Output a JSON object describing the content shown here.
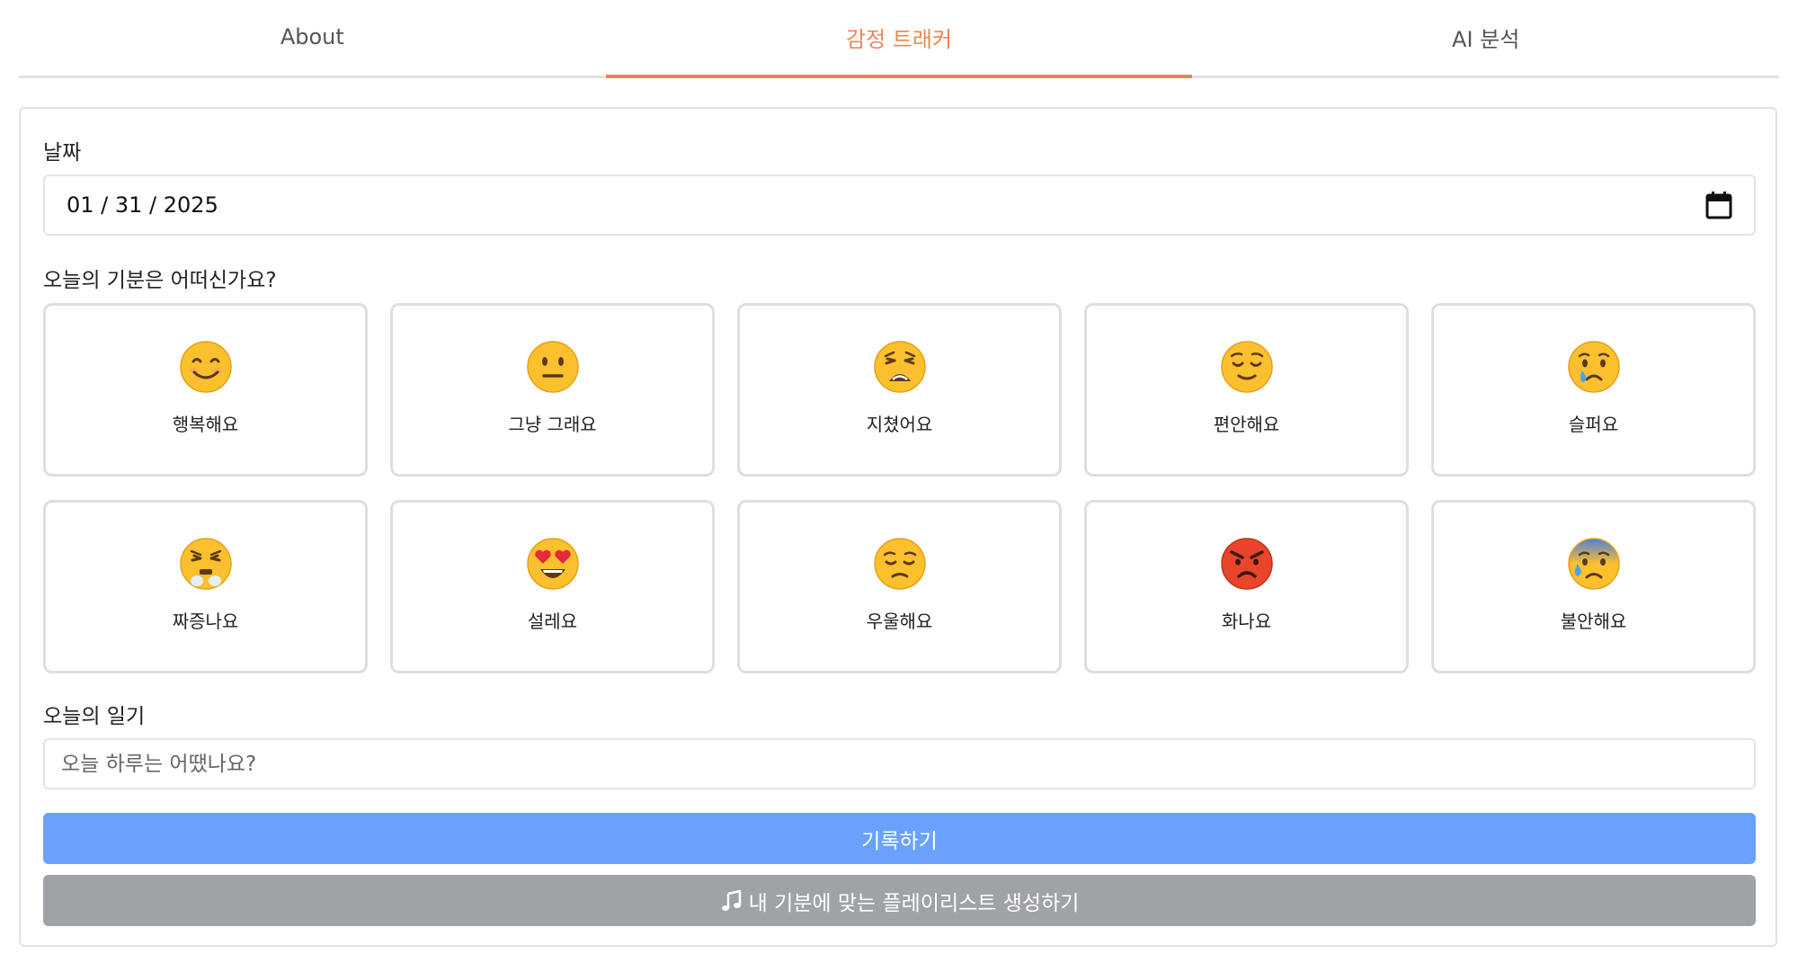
{
  "tabs": [
    {
      "label": "About",
      "active": false
    },
    {
      "label": "감정 트래커",
      "active": true
    },
    {
      "label": "AI 분석",
      "active": false
    }
  ],
  "accent_color": "#f0844e",
  "date_section": {
    "label": "날짜",
    "value": "01 / 31 / 2025",
    "icon": "calendar-icon"
  },
  "mood_section": {
    "label": "오늘의 기분은 어떠신가요?",
    "moods": [
      {
        "emoji": "smiling-face-icon",
        "label": "행복해요"
      },
      {
        "emoji": "neutral-face-icon",
        "label": "그냥 그래요"
      },
      {
        "emoji": "weary-face-icon",
        "label": "지쳤어요"
      },
      {
        "emoji": "relieved-face-icon",
        "label": "편안해요"
      },
      {
        "emoji": "crying-face-icon",
        "label": "슬퍼요"
      },
      {
        "emoji": "steam-nose-face-icon",
        "label": "짜증나요"
      },
      {
        "emoji": "heart-eyes-face-icon",
        "label": "설레요"
      },
      {
        "emoji": "pensive-face-icon",
        "label": "우울해요"
      },
      {
        "emoji": "angry-red-face-icon",
        "label": "화나요"
      },
      {
        "emoji": "anxious-sweat-face-icon",
        "label": "불안해요"
      }
    ]
  },
  "diary_section": {
    "label": "오늘의 일기",
    "placeholder": "오늘 하루는 어땠나요?",
    "value": ""
  },
  "buttons": {
    "record_label": "기록하기",
    "record_color": "#6aa1fc",
    "playlist_label": "내 기분에 맞는 플레이리스트 생성하기",
    "playlist_icon": "music-note-icon",
    "playlist_color": "#9fa3a8"
  }
}
